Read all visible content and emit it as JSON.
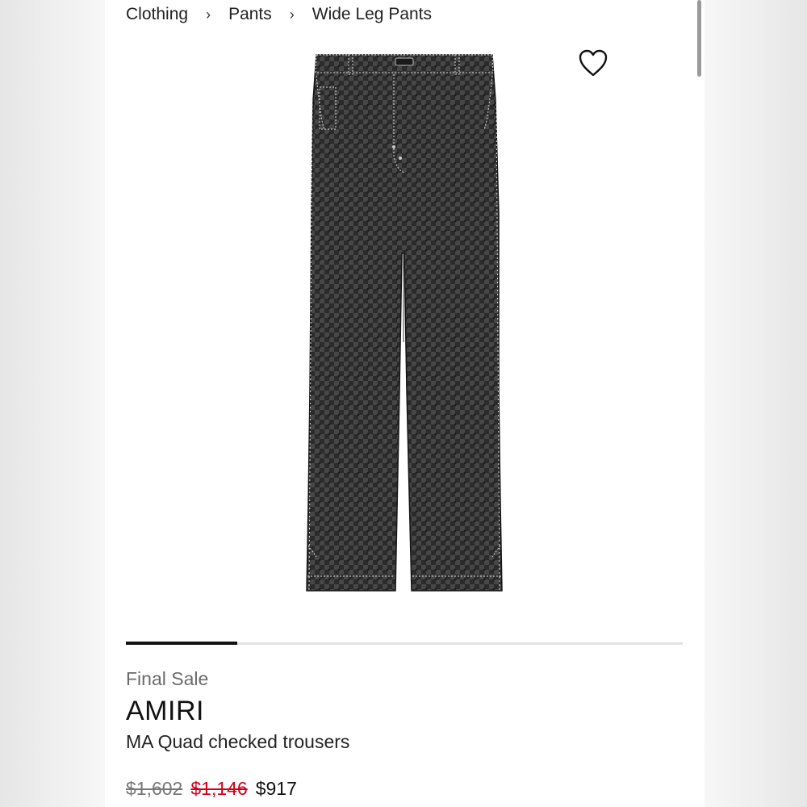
{
  "breadcrumb": {
    "items": [
      "Clothing",
      "Pants",
      "Wide Leg Pants"
    ],
    "separator": "›"
  },
  "product": {
    "sale_label": "Final Sale",
    "brand": "AMIRI",
    "name": "MA Quad checked trousers",
    "prices": {
      "original": "$1,602",
      "previous": "$1,146",
      "current": "$917"
    },
    "image_position_fraction": 0.2,
    "favorite_icon": "heart-outline-icon"
  },
  "colors": {
    "accent_sale": "#d0021b",
    "progress": "#111111"
  }
}
